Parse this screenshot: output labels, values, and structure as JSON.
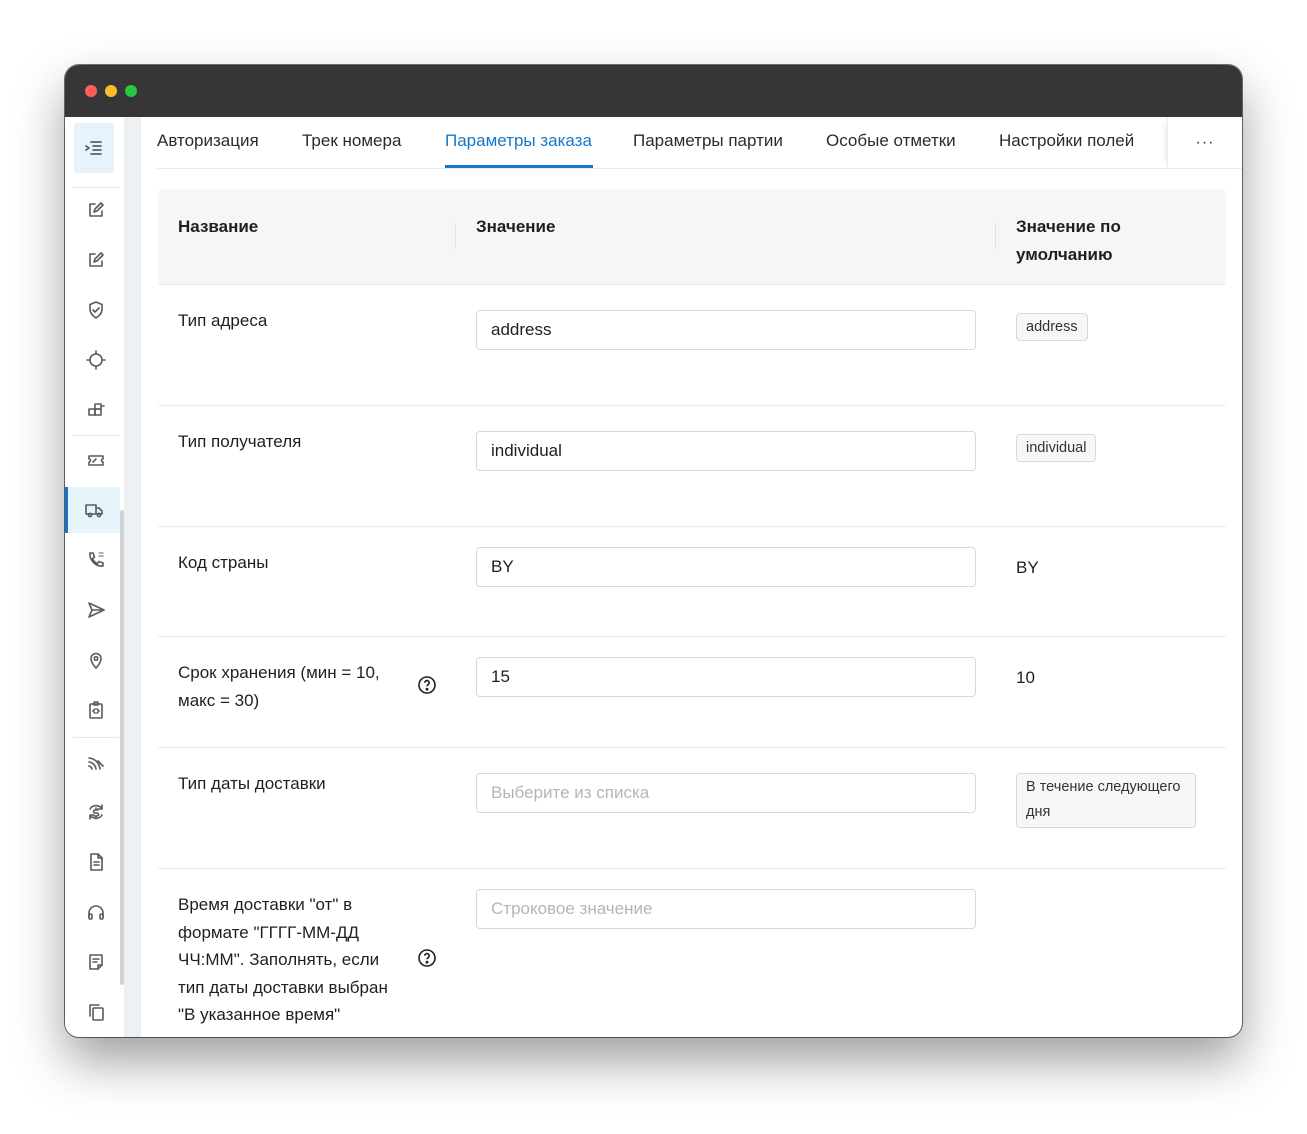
{
  "window": {
    "controls": [
      "close",
      "minimize",
      "maximize"
    ]
  },
  "sidebar": {
    "toggle_icon": "menu-fold-icon",
    "items": [
      {
        "icon": "edit-icon"
      },
      {
        "icon": "edit-icon"
      },
      {
        "icon": "shield-check-icon"
      },
      {
        "icon": "crosshair-icon"
      },
      {
        "icon": "blocks-icon"
      },
      {
        "icon": "ticket-icon"
      },
      {
        "icon": "truck-icon",
        "active": true
      },
      {
        "icon": "sip-phone-icon"
      },
      {
        "icon": "send-icon"
      },
      {
        "icon": "location-pin-icon"
      },
      {
        "icon": "clipboard-code-icon"
      },
      {
        "icon": "signal-icon"
      },
      {
        "icon": "currency-exchange-icon"
      },
      {
        "icon": "document-icon"
      },
      {
        "icon": "headphones-icon"
      },
      {
        "icon": "note-icon"
      },
      {
        "icon": "copy-icon"
      }
    ]
  },
  "tabs": [
    {
      "label": "Авторизация"
    },
    {
      "label": "Трек номера"
    },
    {
      "label": "Параметры заказа",
      "active": true
    },
    {
      "label": "Параметры партии"
    },
    {
      "label": "Особые отметки"
    },
    {
      "label": "Настройки полей"
    }
  ],
  "tabs_more": "···",
  "table": {
    "headers": {
      "name": "Название",
      "value": "Значение",
      "default_line1": "Значение по",
      "default_line2": "умолчанию"
    },
    "rows": [
      {
        "name": "Тип адреса",
        "value": "address",
        "default": "address"
      },
      {
        "name": "Тип получателя",
        "value": "individual",
        "default": "individual"
      },
      {
        "name": "Код страны",
        "value": "BY",
        "default": "BY"
      },
      {
        "name_line1": "Срок хранения (мин = 10,",
        "name_line2": "макс = 30)",
        "value": "15",
        "default": "10"
      },
      {
        "name": "Тип даты доставки",
        "placeholder": "Выберите из списка",
        "default_line1": "В течение следующего",
        "default_line2": "дня"
      },
      {
        "name_lines": [
          "Время доставки \"от\" в",
          "формате \"ГГГГ-ММ-ДД",
          "ЧЧ:ММ\". Заполнять, если",
          "тип даты доставки выбран",
          "\"В указанное время\""
        ],
        "placeholder": "Строковое значение"
      }
    ]
  }
}
